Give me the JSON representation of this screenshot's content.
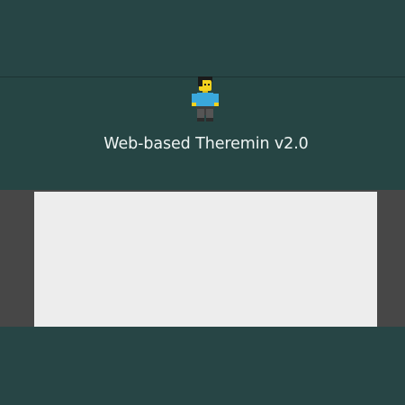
{
  "header": {
    "title": "Web-based Theremin v2.0",
    "mascot_icon": "lego-minifigure-icon"
  },
  "colors": {
    "background": "#264544",
    "stage_border": "#474747",
    "canvas": "#ededed",
    "title_text": "#eef4f3"
  }
}
